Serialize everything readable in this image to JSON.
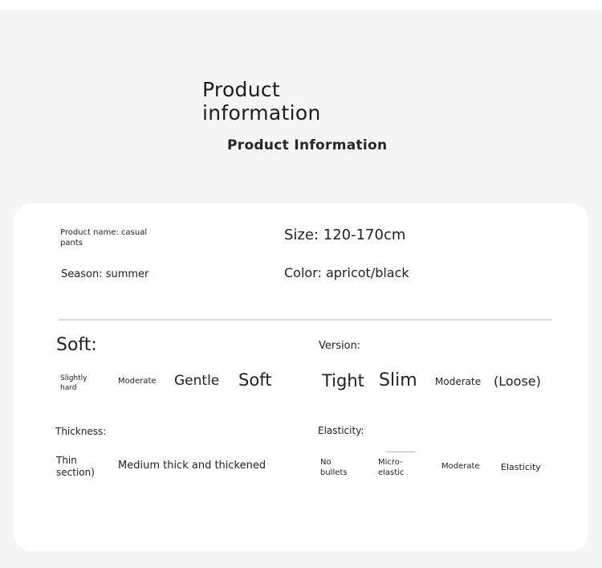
{
  "header": {
    "title": "Product information",
    "subtitle": "Product Information"
  },
  "basic_info": {
    "product_name": "Product name: casual pants",
    "size": "Size: 120-170cm",
    "season": "Season: summer",
    "color": "Color: apricot/black"
  },
  "softness": {
    "label": "Soft:",
    "options": [
      "Slightly hard",
      "Moderate",
      "Gentle",
      "Soft"
    ]
  },
  "version": {
    "label": "Version:",
    "options": [
      "Tight",
      "Slim",
      "Moderate",
      "(Loose)"
    ]
  },
  "thickness": {
    "label": "Thickness:",
    "options": [
      "Thin section)",
      "Medium thick and thickened"
    ]
  },
  "elasticity": {
    "label": "Elasticity:",
    "options": [
      "No bullets",
      "Micro-elastic",
      "Moderate",
      "Elasticity"
    ]
  }
}
